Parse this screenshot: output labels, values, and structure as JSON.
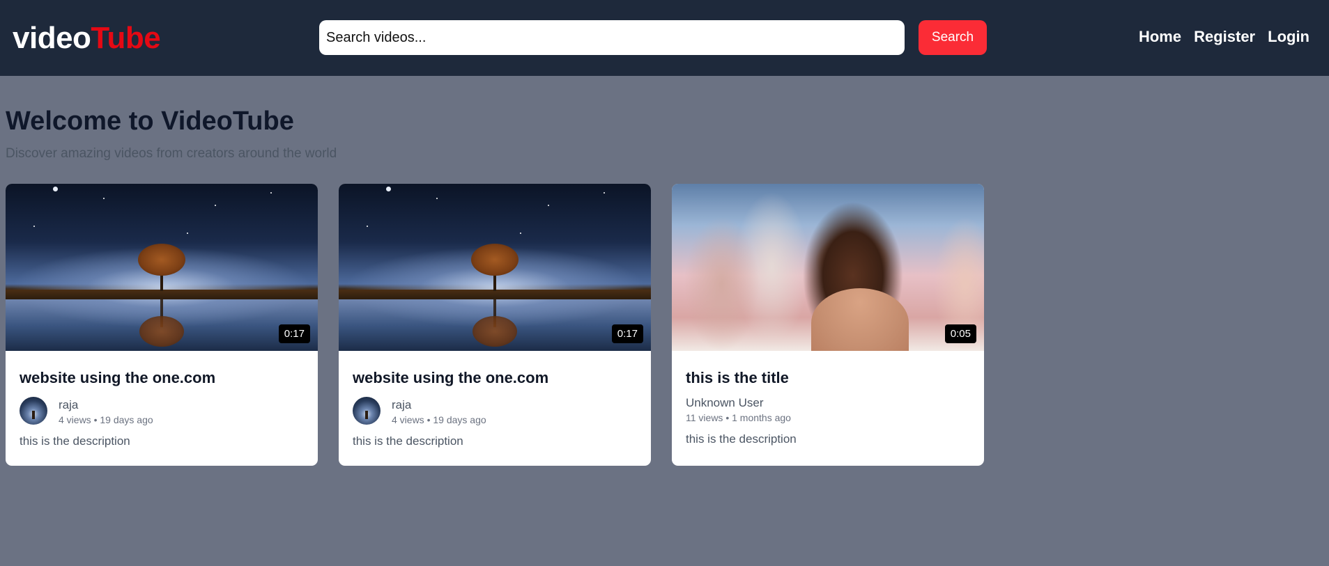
{
  "header": {
    "logo_part1": "video",
    "logo_part2": "Tube",
    "search_placeholder": "Search videos...",
    "search_button": "Search",
    "nav": [
      "Home",
      "Register",
      "Login"
    ]
  },
  "main": {
    "title": "Welcome to VideoTube",
    "subtitle": "Discover amazing videos from creators around the world"
  },
  "videos": [
    {
      "duration": "0:17",
      "title": "website using the one.com",
      "channel": "raja",
      "stats": "4 views • 19 days ago",
      "description": "this is the description",
      "thumbnail": "night-tree-lake"
    },
    {
      "duration": "0:17",
      "title": "website using the one.com",
      "channel": "raja",
      "stats": "4 views • 19 days ago",
      "description": "this is the description",
      "thumbnail": "night-tree-lake"
    },
    {
      "duration": "0:05",
      "title": "this is the title",
      "channel": "Unknown User",
      "stats": "11 views • 1 months ago",
      "description": "this is the description",
      "thumbnail": "woman-portrait"
    }
  ],
  "colors": {
    "header_bg": "#1e293b",
    "page_bg": "#6b7283",
    "brand_red": "#e50914",
    "button_red": "#fb2c36"
  }
}
